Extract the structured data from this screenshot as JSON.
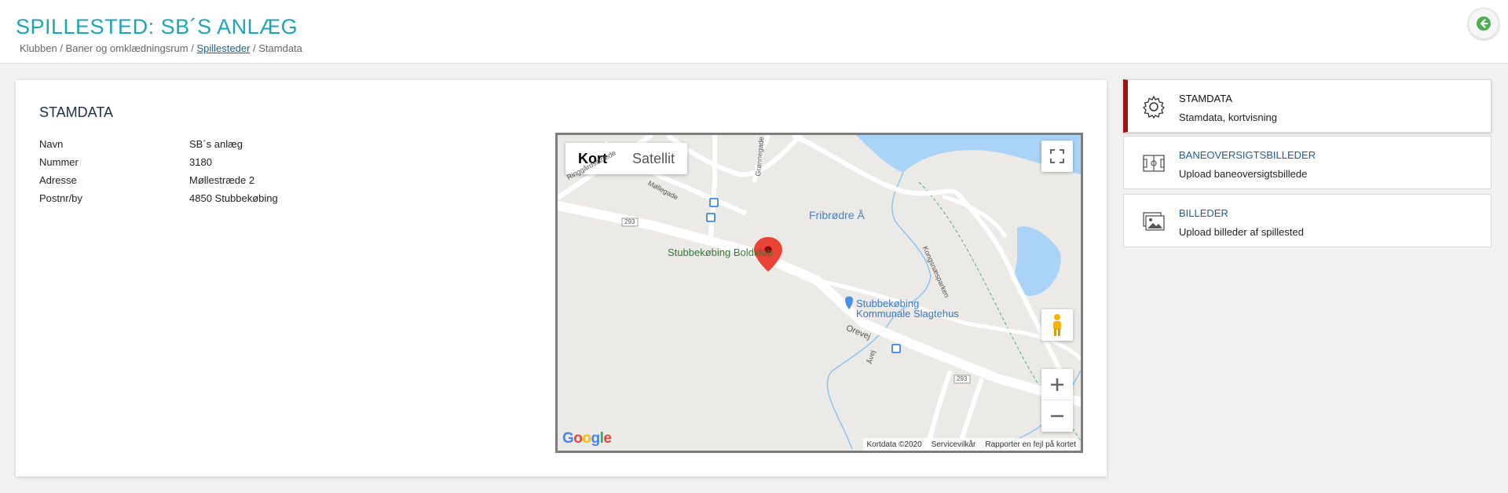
{
  "header": {
    "title": "SPILLESTED: SB´S ANLÆG",
    "breadcrumb": {
      "part1": "Klubben / Baner og omklædningsrum / ",
      "link": "Spillesteder",
      "part2": " / Stamdata"
    },
    "back_icon": "arrow-left-circle-icon"
  },
  "stamdata": {
    "title": "STAMDATA",
    "rows": [
      {
        "label": "Navn",
        "value": "SB´s anlæg"
      },
      {
        "label": "Nummer",
        "value": "3180"
      },
      {
        "label": "Adresse",
        "value": "Møllestræde 2"
      },
      {
        "label": "Postnr/by",
        "value": "4850 Stubbekøbing"
      }
    ]
  },
  "map": {
    "type_active": "Kort",
    "type_inactive": "Satellit",
    "labels": {
      "club": "Stubbekøbing Boldklub",
      "river": "Fribrødre Å",
      "poi_line1": "Stubbekøbing",
      "poi_line2": "Kommunale Slagtehus",
      "road_ringgaard": "Ringgårdsstræde",
      "road_moelle": "Møllegade",
      "road_grønne": "Grønnegade",
      "road_orevej": "Orevej",
      "road_kongsnaes": "Kongsnæsparken",
      "road_avej": "Åvej",
      "route_293a": "293",
      "route_293b": "293"
    },
    "logo": "Google",
    "attribution": {
      "data": "Kortdata ©2020",
      "terms": "Servicevilkår",
      "report": "Rapporter en fejl på kortet"
    }
  },
  "sidebar": [
    {
      "title": "STAMDATA",
      "subtitle": "Stamdata, kortvisning",
      "icon": "gear-icon",
      "active": true
    },
    {
      "title": "BANEOVERSIGTSBILLEDER",
      "subtitle": "Upload baneoversigtsbillede",
      "icon": "field-layout-icon",
      "active": false
    },
    {
      "title": "BILLEDER",
      "subtitle": "Upload billeder af spillested",
      "icon": "images-icon",
      "active": false
    }
  ],
  "colors": {
    "title": "#1ba6b8",
    "active_marker": "#9b1313",
    "link": "#1b5e9c",
    "back_button": "#4caf50"
  }
}
